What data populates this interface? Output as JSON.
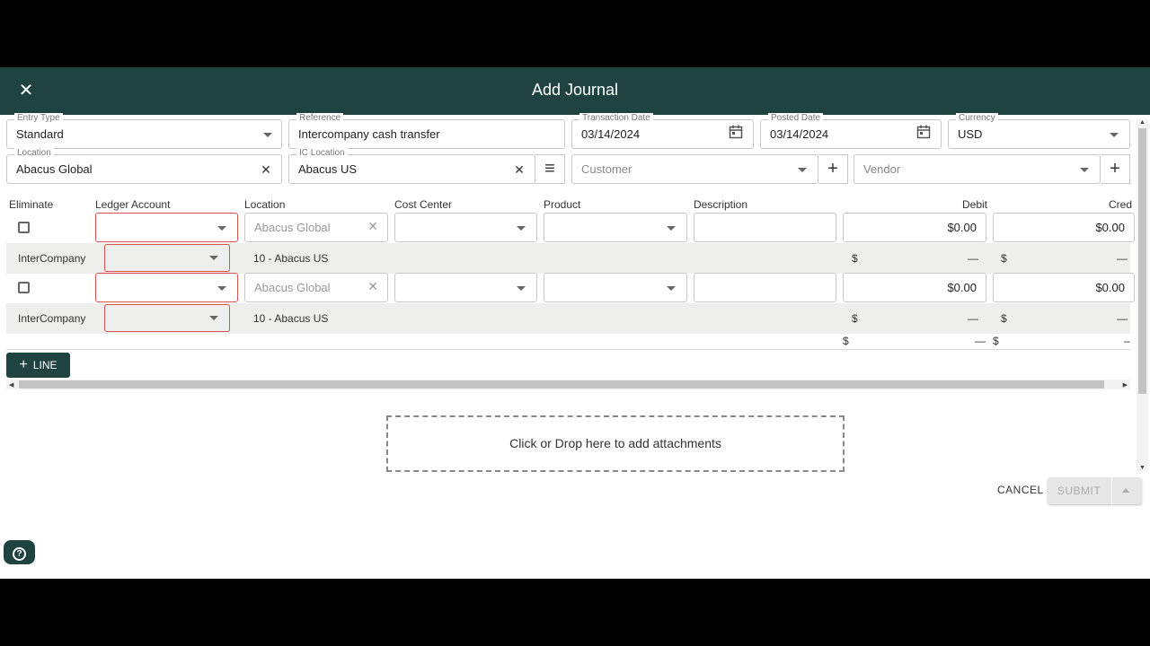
{
  "dialog": {
    "title": "Add Journal"
  },
  "header_fields": {
    "entry_type": {
      "label": "Entry Type",
      "value": "Standard"
    },
    "reference": {
      "label": "Reference",
      "value": "Intercompany cash transfer"
    },
    "transaction_date": {
      "label": "Transaction Date",
      "value": "03/14/2024"
    },
    "posted_date": {
      "label": "Posted Date",
      "value": "03/14/2024"
    },
    "currency": {
      "label": "Currency",
      "value": "USD"
    },
    "location": {
      "label": "Location",
      "value": "Abacus Global"
    },
    "ic_location": {
      "label": "IC Location",
      "value": "Abacus US"
    },
    "customer": {
      "placeholder": "Customer"
    },
    "vendor": {
      "placeholder": "Vendor"
    }
  },
  "columns": [
    "Eliminate",
    "Ledger Account",
    "Location",
    "Cost Center",
    "Product",
    "Description",
    "Debit",
    "Cred"
  ],
  "lines": [
    {
      "location_placeholder": "Abacus Global",
      "debit": "$0.00",
      "credit": "$0.00",
      "ic_label": "InterCompany",
      "ic_location": "10 - Abacus US",
      "ic_debit_sym": "$",
      "ic_debit": "—",
      "ic_credit_sym": "$",
      "ic_credit": "—"
    },
    {
      "location_placeholder": "Abacus Global",
      "debit": "$0.00",
      "credit": "$0.00",
      "ic_label": "InterCompany",
      "ic_location": "10 - Abacus US",
      "ic_debit_sym": "$",
      "ic_debit": "—",
      "ic_credit_sym": "$",
      "ic_credit": "—"
    }
  ],
  "totals": {
    "debit_sym": "$",
    "debit": "—",
    "credit_sym": "$",
    "credit": "–"
  },
  "add_line_label": "LINE",
  "attachments_label": "Click or Drop here to add attachments",
  "actions": {
    "cancel": "CANCEL",
    "submit": "SUBMIT"
  },
  "icons": {
    "close": "close-icon",
    "calendar": "calendar-icon",
    "menu": "menu-icon",
    "add": "plus-icon",
    "help": "help-icon"
  },
  "colors": {
    "primary": "#1e4341",
    "error": "#d9534f"
  }
}
